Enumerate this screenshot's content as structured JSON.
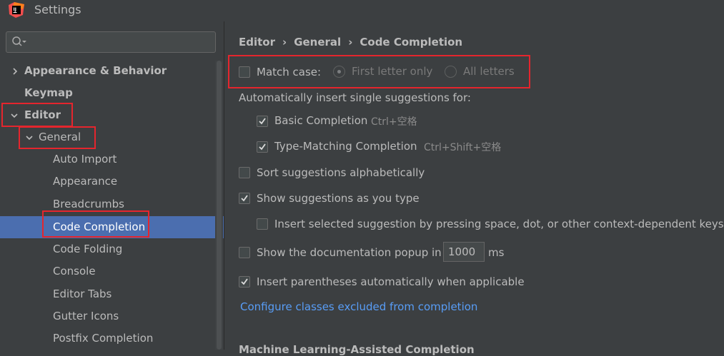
{
  "window": {
    "title": "Settings"
  },
  "sidebar": {
    "search_placeholder": "",
    "items": [
      {
        "label": "Appearance & Behavior",
        "level": 0,
        "expanded": false
      },
      {
        "label": "Keymap",
        "level": 0
      },
      {
        "label": "Editor",
        "level": 0,
        "expanded": true
      },
      {
        "label": "General",
        "level": 1,
        "expanded": true
      },
      {
        "label": "Auto Import",
        "level": 2
      },
      {
        "label": "Appearance",
        "level": 2
      },
      {
        "label": "Breadcrumbs",
        "level": 2
      },
      {
        "label": "Code Completion",
        "level": 2,
        "selected": true
      },
      {
        "label": "Code Folding",
        "level": 2
      },
      {
        "label": "Console",
        "level": 2
      },
      {
        "label": "Editor Tabs",
        "level": 2
      },
      {
        "label": "Gutter Icons",
        "level": 2
      },
      {
        "label": "Postfix Completion",
        "level": 2
      }
    ]
  },
  "content": {
    "breadcrumb": [
      "Editor",
      "General",
      "Code Completion"
    ],
    "match_case": {
      "label": "Match case:",
      "checked": false
    },
    "match_case_options": [
      {
        "label": "First letter only",
        "selected": true
      },
      {
        "label": "All letters",
        "selected": false
      }
    ],
    "auto_insert_heading": "Automatically insert single suggestions for:",
    "basic_completion": {
      "label": "Basic Completion",
      "shortcut": "Ctrl+空格",
      "checked": true
    },
    "type_matching": {
      "label": "Type-Matching Completion",
      "shortcut": "Ctrl+Shift+空格",
      "checked": true
    },
    "sort_alpha": {
      "label": "Sort suggestions alphabetically",
      "checked": false
    },
    "show_as_type": {
      "label": "Show suggestions as you type",
      "checked": true
    },
    "insert_selected": {
      "label": "Insert selected suggestion by pressing space, dot, or other context-dependent keys",
      "checked": false
    },
    "doc_popup": {
      "label": "Show the documentation popup in",
      "value": "1000",
      "unit": "ms",
      "checked": false
    },
    "parentheses": {
      "label": "Insert parentheses automatically when applicable",
      "checked": true
    },
    "configure_link": "Configure classes excluded from completion",
    "next_section": "Machine Learning-Assisted Completion"
  },
  "colors": {
    "background": "#3c3f41",
    "selection": "#4b6eaf",
    "link": "#589df6",
    "highlight": "#e5252d"
  }
}
